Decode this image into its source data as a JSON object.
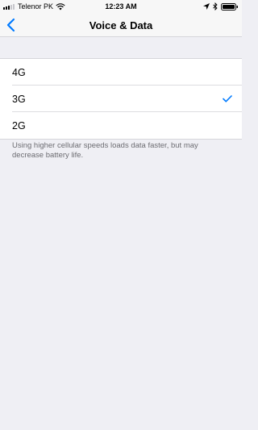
{
  "status_bar": {
    "carrier": "Telenor PK",
    "time": "12:23 AM",
    "signal_bars_active": 3,
    "signal_bars_total": 5
  },
  "nav": {
    "title": "Voice & Data",
    "back_icon": "chevron-left-icon"
  },
  "options": [
    {
      "label": "4G",
      "selected": false
    },
    {
      "label": "3G",
      "selected": true
    },
    {
      "label": "2G",
      "selected": false
    }
  ],
  "footer_text": "Using higher cellular speeds loads data faster, but may decrease battery life.",
  "colors": {
    "accent": "#007aff",
    "background": "#efeff4",
    "footer_text": "#6d6d72"
  }
}
